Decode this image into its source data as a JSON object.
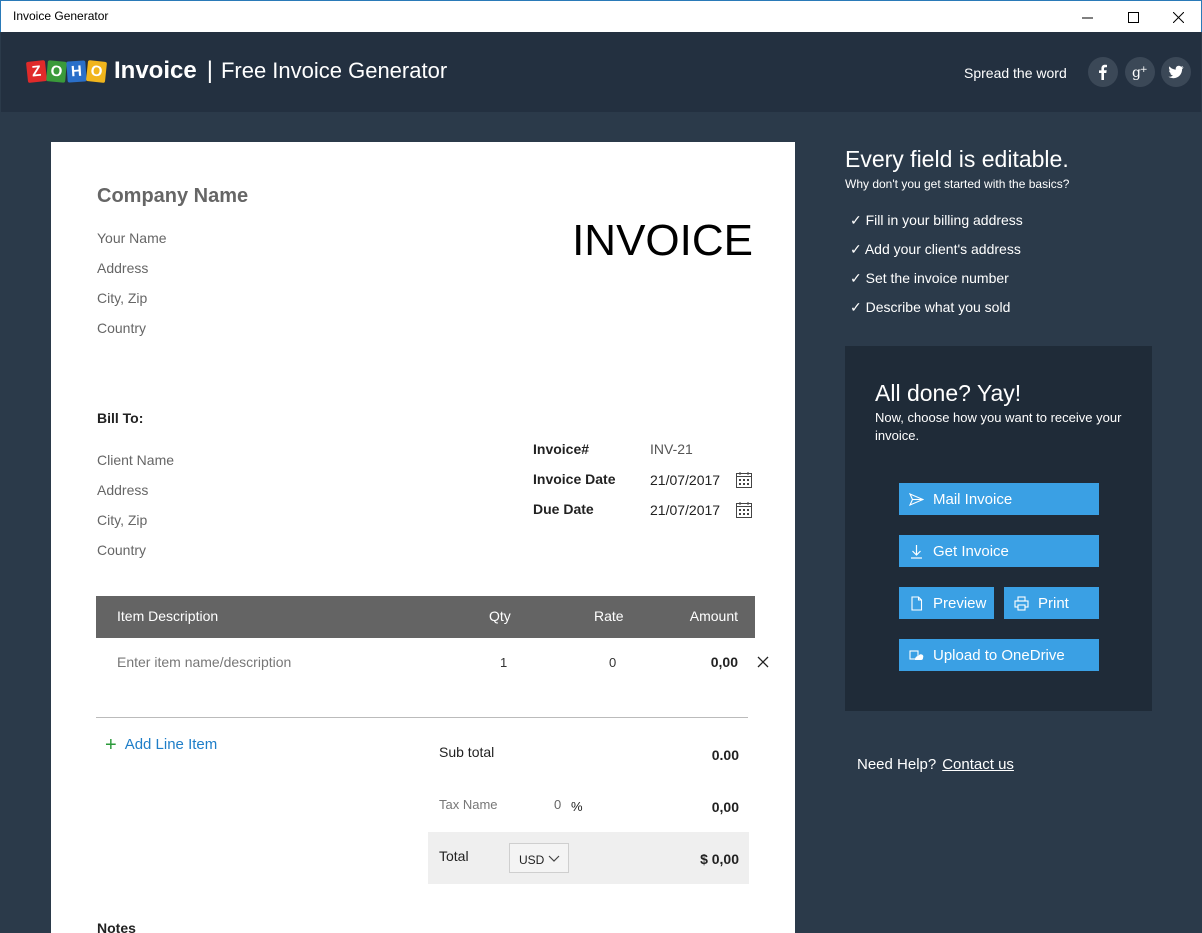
{
  "window": {
    "title": "Invoice Generator"
  },
  "header": {
    "logo_letters": [
      "Z",
      "O",
      "H",
      "O"
    ],
    "logo_product": "Invoice",
    "separator": "|",
    "subtitle": "Free Invoice Generator",
    "spread_label": "Spread the word",
    "social_icons": [
      "facebook-icon",
      "google-plus-icon",
      "twitter-icon"
    ]
  },
  "invoice": {
    "company_name": "Company Name",
    "from": [
      "Your Name",
      "Address",
      "City, Zip",
      "Country"
    ],
    "title": "INVOICE",
    "bill_to_label": "Bill To:",
    "client": [
      "Client Name",
      "Address",
      "City, Zip",
      "Country"
    ],
    "meta": {
      "invoice_no_label": "Invoice#",
      "invoice_no": "INV-21",
      "invoice_date_label": "Invoice Date",
      "invoice_date": "21/07/2017",
      "due_date_label": "Due Date",
      "due_date": "21/07/2017"
    },
    "table": {
      "headers": {
        "desc": "Item Description",
        "qty": "Qty",
        "rate": "Rate",
        "amount": "Amount"
      },
      "rows": [
        {
          "desc_placeholder": "Enter item name/description",
          "qty": "1",
          "rate": "0",
          "amount": "0,00"
        }
      ]
    },
    "add_line_label": "Add Line Item",
    "add_line_icon": "+",
    "totals": {
      "subtotal_label": "Sub total",
      "subtotal": "0.00",
      "tax_label": "Tax Name",
      "tax_rate": "0",
      "tax_unit": "%",
      "tax_amount": "0,00",
      "total_label": "Total",
      "currency": "USD",
      "total": "$ 0,00"
    },
    "notes_label": "Notes"
  },
  "sidebar": {
    "title": "Every field is editable.",
    "subtitle": "Why don't you get started with the basics?",
    "checklist": [
      "✓ Fill in your billing address",
      "✓ Add your client's address",
      "✓ Set the invoice number",
      "✓ Describe what you sold"
    ],
    "done_title": "All done? Yay!",
    "done_sub": "Now, choose how you want to receive your invoice.",
    "buttons": {
      "mail": "Mail Invoice",
      "get": "Get Invoice",
      "preview": "Preview",
      "print": "Print",
      "onedrive": "Upload to OneDrive"
    },
    "help_label": "Need Help?",
    "contact_label": "Contact us"
  },
  "colors": {
    "header_bg": "#233040",
    "main_bg": "#2b3a4a",
    "panel_bg": "#1f2b38",
    "button_blue": "#3aa0e4",
    "table_header": "#646464",
    "link_blue": "#1e7ec8",
    "plus_green": "#2b9a3a"
  }
}
